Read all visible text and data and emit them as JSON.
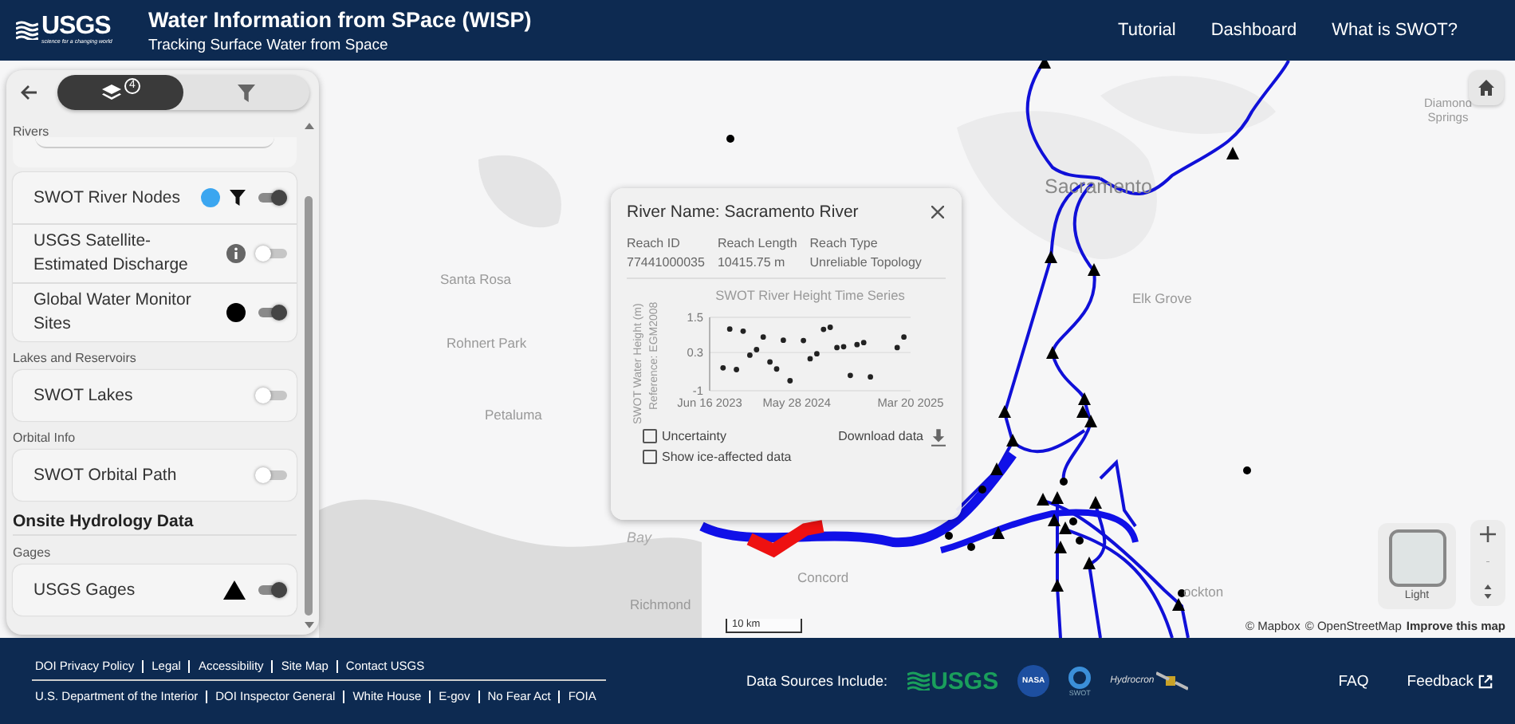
{
  "header": {
    "logo": {
      "text": "USGS",
      "tagline": "science for a changing world"
    },
    "title": "Water Information from SPace (WISP)",
    "subtitle": "Tracking Surface Water from Space",
    "nav": [
      {
        "label": "Tutorial"
      },
      {
        "label": "Dashboard"
      },
      {
        "label": "What is SWOT?"
      }
    ]
  },
  "sidebar": {
    "tabs": [
      {
        "kind": "layers",
        "badge": "4",
        "selected": true
      },
      {
        "kind": "filter",
        "selected": false
      }
    ],
    "sections": [
      {
        "kind": "label",
        "text": "Rivers"
      },
      {
        "kind": "stub"
      },
      {
        "kind": "card",
        "items": [
          {
            "label": "SWOT River Nodes",
            "symbols": [
              {
                "kind": "dot",
                "color": "#3ba6f0"
              },
              {
                "kind": "filter"
              }
            ],
            "on": true
          },
          {
            "label": "USGS Satellite-Estimated Discharge",
            "symbols": [
              {
                "kind": "info"
              }
            ],
            "on": false
          },
          {
            "label": "Global Water Monitor Sites",
            "symbols": [
              {
                "kind": "dot",
                "color": "#000000"
              }
            ],
            "on": true
          }
        ]
      },
      {
        "kind": "label",
        "text": "Lakes and Reservoirs"
      },
      {
        "kind": "card",
        "items": [
          {
            "label": "SWOT Lakes",
            "on": false
          }
        ]
      },
      {
        "kind": "label",
        "text": "Orbital Info"
      },
      {
        "kind": "card",
        "items": [
          {
            "label": "SWOT Orbital Path",
            "on": false
          }
        ]
      },
      {
        "kind": "heading",
        "text": "Onsite Hydrology Data"
      },
      {
        "kind": "label",
        "text": "Gages"
      },
      {
        "kind": "card",
        "items": [
          {
            "label": "USGS Gages",
            "symbols": [
              {
                "kind": "triangle"
              }
            ],
            "on": true
          }
        ]
      }
    ]
  },
  "map": {
    "places": [
      {
        "name": "Sacramento",
        "kind": "city"
      },
      {
        "name": "Diamond Springs",
        "kind": "town"
      },
      {
        "name": "Elk Grove",
        "kind": "town"
      },
      {
        "name": "Santa Rosa",
        "kind": "town"
      },
      {
        "name": "Rohnert Park",
        "kind": "town"
      },
      {
        "name": "Petaluma",
        "kind": "town"
      },
      {
        "name": "Bay",
        "kind": "water"
      },
      {
        "name": "Concord",
        "kind": "town"
      },
      {
        "name": "Richmond",
        "kind": "town"
      },
      {
        "name": "ockton",
        "kind": "town"
      }
    ],
    "basemap": "Light",
    "scale": "10 km",
    "attribution": [
      {
        "label": "© Mapbox",
        "bold": false
      },
      {
        "label": "© OpenStreetMap",
        "bold": false
      },
      {
        "label": "Improve this map",
        "bold": true
      }
    ]
  },
  "popup": {
    "title": "River Name: Sacramento River",
    "fields": [
      {
        "label": "Reach ID",
        "value": "77441000035"
      },
      {
        "label": "Reach Length",
        "value": "10415.75 m"
      },
      {
        "label": "Reach Type",
        "value": "Unreliable Topology"
      }
    ],
    "y_reference": "Reference: EGM2008",
    "chart_data": {
      "type": "scatter",
      "title": "SWOT River Height Time Series",
      "ylabel": "SWOT Water Height (m)",
      "categories": [
        "Jun 16 2023",
        null,
        null,
        null,
        null,
        null,
        null,
        null,
        null,
        null,
        null,
        null,
        null,
        "May 28 2024",
        null,
        null,
        null,
        null,
        null,
        null,
        null,
        null,
        null,
        null,
        null,
        null,
        null,
        null,
        null,
        null,
        "Mar 20 2025"
      ],
      "series": [
        {
          "color": "#222222",
          "values": [
            null,
            null,
            -0.22,
            1.1,
            -0.28,
            1.03,
            0.21,
            0.4,
            0.83,
            -0.02,
            -0.26,
            0.72,
            -0.66,
            null,
            0.71,
            0.09,
            0.26,
            1.09,
            1.16,
            0.47,
            0.5,
            -0.48,
            0.57,
            0.64,
            -0.53,
            null,
            null,
            null,
            0.47,
            0.83,
            null
          ]
        }
      ],
      "ylim": [
        -1,
        1.5
      ],
      "yticks": [
        -1,
        0.3,
        1.5
      ]
    },
    "options": [
      {
        "label": "Uncertainty",
        "checked": false
      },
      {
        "label": "Show ice-affected data",
        "checked": false
      }
    ],
    "download": "Download data"
  },
  "footer": {
    "links_top": [
      "DOI Privacy Policy",
      "Legal",
      "Accessibility",
      "Site Map",
      "Contact USGS"
    ],
    "links_bottom": [
      "U.S. Department of the Interior",
      "DOI Inspector General",
      "White House",
      "E-gov",
      "No Fear Act",
      "FOIA"
    ],
    "sources_label": "Data Sources Include:",
    "sources": [
      {
        "kind": "usgs",
        "text": "USGS"
      },
      {
        "kind": "nasa",
        "text": "NASA"
      },
      {
        "kind": "swot",
        "text": "SWOT"
      },
      {
        "kind": "hydrocron",
        "text": "Hydrocron"
      }
    ],
    "links_right": [
      {
        "label": "FAQ",
        "external": false
      },
      {
        "label": "Feedback",
        "external": true
      }
    ]
  }
}
